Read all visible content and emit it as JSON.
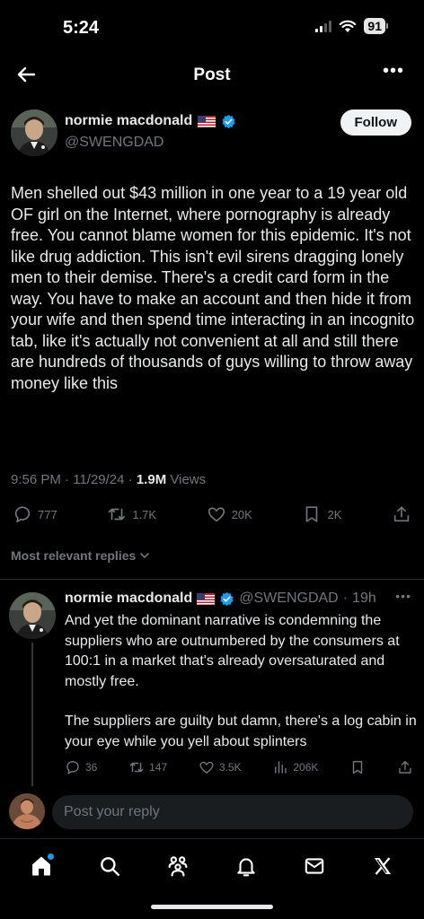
{
  "status_bar": {
    "time": "5:24",
    "battery": "91"
  },
  "header": {
    "title": "Post"
  },
  "post": {
    "author_name": "normie macdonald",
    "author_handle": "@SWENGDAD",
    "follow_label": "Follow",
    "text": "Men shelled out $43 million in one year to a 19 year old OF girl on the Internet, where pornography is already free. You cannot blame women for this epidemic. It's not like drug addiction. This isn't evil sirens dragging lonely men to their demise. There's a credit card form in the way. You have to make an account and then hide it from your wife and then spend time interacting in an incognito tab, like it's actually not convenient at all and still there are hundreds of thousands of guys willing to throw away money like this",
    "time": "9:56 PM",
    "date": "11/29/24",
    "views_count": "1.9M",
    "views_label": "Views",
    "replies": "777",
    "reposts": "1.7K",
    "likes": "20K",
    "bookmarks": "2K"
  },
  "replies_filter": {
    "label": "Most relevant replies"
  },
  "reply": {
    "author_name": "normie macdonald",
    "author_handle": "@SWENGDAD",
    "age": "19h",
    "text_p1": "And yet the dominant narrative is condemning the suppliers who are outnumbered by the consumers at 100:1 in a market that's already oversaturated and mostly free.",
    "text_p2": "The suppliers are guilty but damn, there's a log cabin in your eye while you yell about splinters",
    "replies": "36",
    "reposts": "147",
    "likes": "3.5K",
    "views": "206K"
  },
  "composer": {
    "placeholder": "Post your reply"
  },
  "tabs": [
    "home-icon",
    "search-icon",
    "communities-icon",
    "notifications-icon",
    "messages-icon",
    "x-logo-icon"
  ],
  "colors": {
    "background": "#000000",
    "text": "#e7e9ea",
    "muted": "#71767b",
    "verified": "#1d9bf0",
    "accent": "#1d9bf0"
  }
}
